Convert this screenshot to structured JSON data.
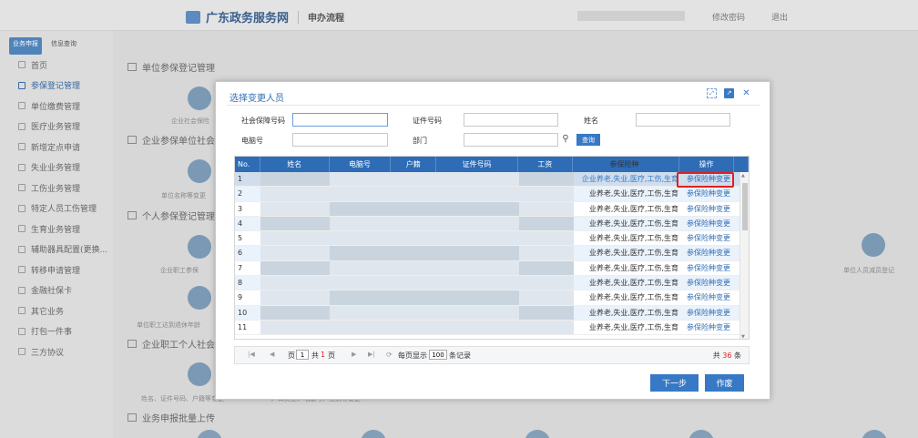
{
  "header": {
    "site_name": "广东政务服务网",
    "page_name": "申办流程",
    "change_password": "修改密码",
    "logout": "退出"
  },
  "sidebar": {
    "tabs": [
      "业务申报",
      "信息查询"
    ],
    "items": [
      {
        "label": "首页",
        "active": false
      },
      {
        "label": "参保登记管理",
        "active": true
      },
      {
        "label": "单位缴费管理",
        "active": false
      },
      {
        "label": "医疗业务管理",
        "active": false
      },
      {
        "label": "新增定点申请",
        "active": false
      },
      {
        "label": "失业业务管理",
        "active": false
      },
      {
        "label": "工伤业务管理",
        "active": false
      },
      {
        "label": "特定人员工伤管理",
        "active": false
      },
      {
        "label": "生育业务管理",
        "active": false
      },
      {
        "label": "辅助器具配置(更换...",
        "active": false
      },
      {
        "label": "转移申请管理",
        "active": false
      },
      {
        "label": "金融社保卡",
        "active": false
      },
      {
        "label": "其它业务",
        "active": false
      },
      {
        "label": "打包一件事",
        "active": false
      },
      {
        "label": "三方协议",
        "active": false
      }
    ]
  },
  "background": {
    "sections": [
      "单位参保登记管理",
      "企业参保单位社会",
      "个人参保登记管理",
      "企业职工个人社会",
      "业务申报批量上传"
    ],
    "labels": [
      "企业社会保险",
      "单位名称等变更",
      "企业职工参保",
      "单位职工达到退休年龄",
      "单位人员减员登记",
      "姓名、证件号码、户籍等变更",
      "户口类型、电脑号、性别等变更"
    ]
  },
  "modal": {
    "title": "选择变更人员",
    "filters": {
      "ss_no_label": "社会保障号码",
      "id_label": "证件号码",
      "name_label": "姓名",
      "pc_label": "电脑号",
      "dept_label": "部门",
      "query_button": "查询"
    },
    "table": {
      "columns": [
        "No.",
        "姓名",
        "电脑号",
        "户籍",
        "证件号码",
        "工资",
        "参保险种",
        "操作"
      ],
      "rows": [
        {
          "no": "1",
          "insurance": "企业养老,失业,医疗,工伤,生育",
          "op": "参保险种变更"
        },
        {
          "no": "2",
          "insurance": "业养老,失业,医疗,工伤,生育",
          "op": "参保险种变更"
        },
        {
          "no": "3",
          "insurance": "业养老,失业,医疗,工伤,生育",
          "op": "参保险种变更"
        },
        {
          "no": "4",
          "insurance": "业养老,失业,医疗,工伤,生育",
          "op": "参保险种变更"
        },
        {
          "no": "5",
          "insurance": "业养老,失业,医疗,工伤,生育",
          "op": "参保险种变更"
        },
        {
          "no": "6",
          "insurance": "业养老,失业,医疗,工伤,生育",
          "op": "参保险种变更"
        },
        {
          "no": "7",
          "insurance": "业养老,失业,医疗,工伤,生育",
          "op": "参保险种变更"
        },
        {
          "no": "8",
          "insurance": "业养老,失业,医疗,工伤,生育",
          "op": "参保险种变更"
        },
        {
          "no": "9",
          "insurance": "业养老,失业,医疗,工伤,生育",
          "op": "参保险种变更"
        },
        {
          "no": "10",
          "insurance": "业养老,失业,医疗,工伤,生育",
          "op": "参保险种变更"
        },
        {
          "no": "11",
          "insurance": "业养老,失业,医疗,工伤,生育",
          "op": "参保险种变更"
        }
      ]
    },
    "pager": {
      "page_prefix": "页",
      "page_value": "1",
      "page_suffix_pre": "共",
      "page_total": "1",
      "page_suffix_post": "页",
      "per_page_prefix": "每页显示",
      "per_page_value": "100",
      "per_page_suffix": "条记录",
      "total_prefix": "共",
      "total_count": "36",
      "total_suffix": "条"
    },
    "next_button": "下一步",
    "void_button": "作废"
  },
  "colors": {
    "primary": "#3779c4",
    "header_blue": "#2e6cb6",
    "highlight_red": "#e02020"
  }
}
